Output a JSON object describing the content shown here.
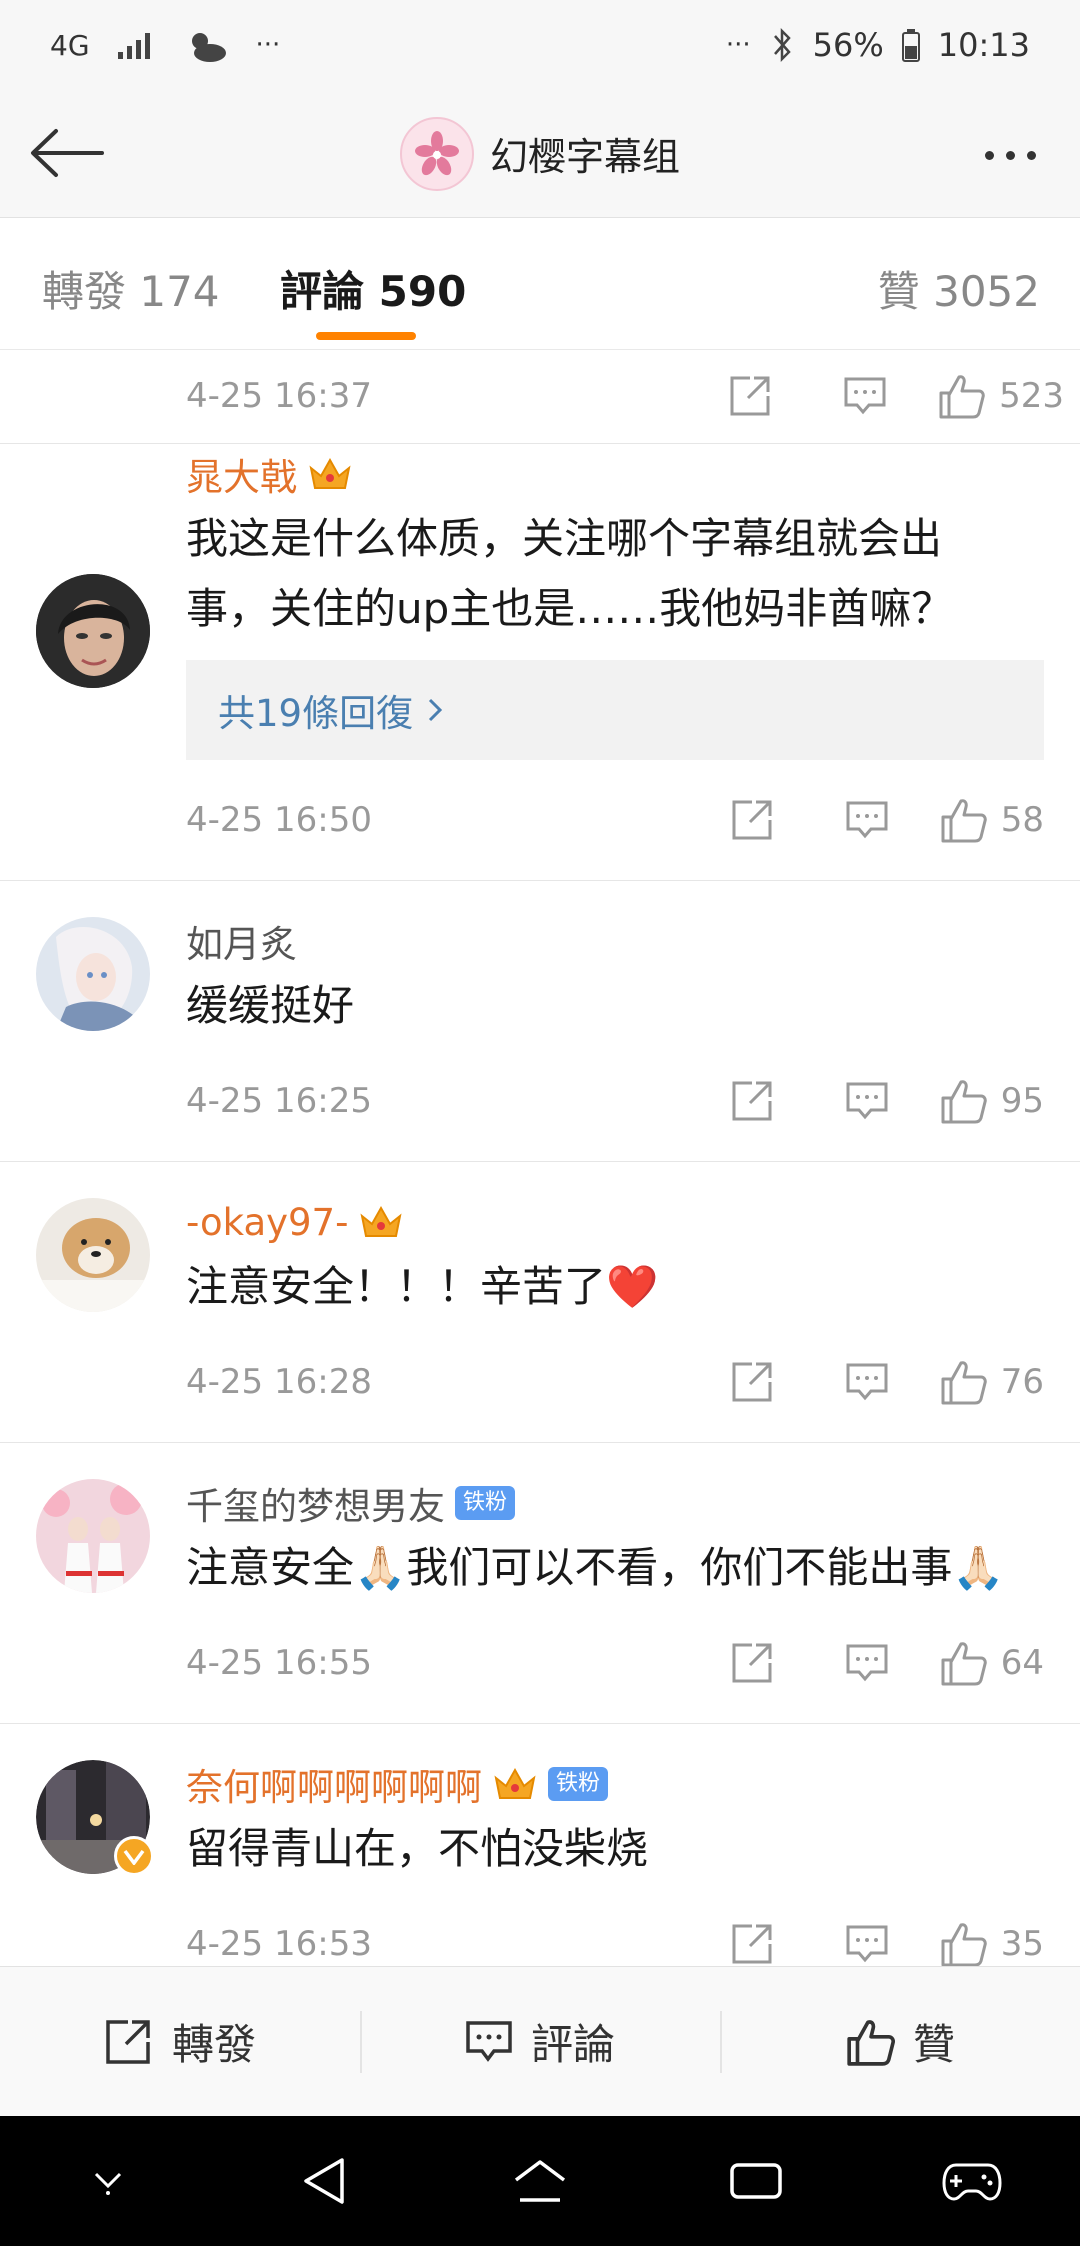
{
  "status_bar": {
    "network": "4G",
    "battery": "56%",
    "time": "10:13",
    "dots": "···"
  },
  "header": {
    "title": "幻樱字幕组",
    "back_icon": "back-arrow-icon",
    "more_icon": "more-dots-icon"
  },
  "tabs": [
    {
      "label": "轉發 174"
    },
    {
      "label": "評論 590"
    },
    {
      "label": "贊 3052"
    }
  ],
  "accent_color": "#ff8200",
  "top_item": {
    "time": "4-25 16:37",
    "likes": "523"
  },
  "comments": [
    {
      "user": "晁大戟",
      "text_line1": "我这是什么体质，关注哪个字幕组就会出",
      "text_line2": "事，关住的up主也是……我他妈非酋嘛？",
      "replies_link": "共19條回復",
      "time": "4-25 16:50",
      "likes": "58"
    },
    {
      "user": "如月炙",
      "text": "缓缓挺好",
      "time": "4-25 16:25",
      "likes": "95"
    },
    {
      "user": "-okay97-",
      "text": "注意安全！！！辛苦了",
      "emoji": "❤️",
      "time": "4-25 16:28",
      "likes": "76"
    },
    {
      "user": "千玺的梦想男友",
      "badge": "铁粉",
      "text_a": "注意安全",
      "emoji": "🙏🏻",
      "text_b": "我们可以不看，你们不能出事",
      "time": "4-25 16:55",
      "likes": "64"
    },
    {
      "user": "奈何啊啊啊啊啊啊",
      "badge": "铁粉",
      "text": "留得青山在，不怕没柴烧",
      "time": "4-25 16:53",
      "likes": "35"
    }
  ],
  "bottom_bar": {
    "repost": "轉發",
    "comment": "評論",
    "like": "贊"
  }
}
